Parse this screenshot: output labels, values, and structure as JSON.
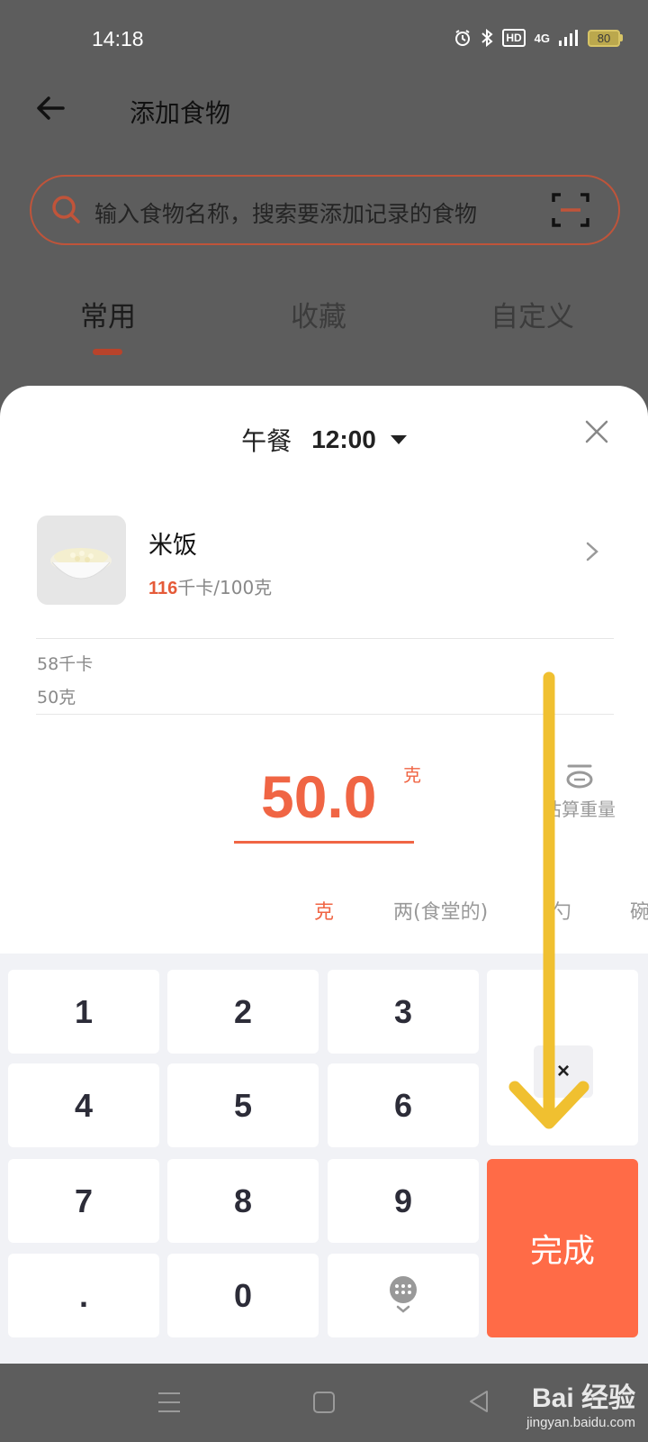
{
  "status_bar": {
    "time": "14:18",
    "hd_label": "HD",
    "network": "4G",
    "battery": "80",
    "icons": [
      "alarm-icon",
      "bluetooth-icon",
      "signal-icon",
      "battery-icon"
    ]
  },
  "header": {
    "title": "添加食物"
  },
  "search": {
    "placeholder": "输入食物名称，搜索要添加记录的食物"
  },
  "tabs": [
    {
      "label": "常用",
      "active": true
    },
    {
      "label": "收藏",
      "active": false
    },
    {
      "label": "自定义",
      "active": false
    }
  ],
  "sheet": {
    "meal": "午餐",
    "time": "12:00",
    "food": {
      "name": "米饭",
      "calories": "116",
      "calories_suffix": "千卡/100克"
    },
    "summary": {
      "calories": "58千卡",
      "weight": "50克"
    },
    "amount": {
      "value": "50.0",
      "unit": "克"
    },
    "estimate_label": "估算重量",
    "units": [
      {
        "label": "克",
        "active": true
      },
      {
        "label": "两(食堂的)",
        "active": false
      },
      {
        "label": "勺",
        "active": false
      },
      {
        "label": "碗",
        "active": false
      }
    ]
  },
  "keypad": {
    "keys": [
      "1",
      "2",
      "3",
      "4",
      "5",
      "6",
      "7",
      "8",
      "9",
      ".",
      "0"
    ],
    "delete_label": "×",
    "done_label": "完成"
  },
  "colors": {
    "accent": "#f06544",
    "done_button": "#ff6b47",
    "overlay_arrow": "#f0c030"
  },
  "watermark": {
    "brand": "Bai 经验",
    "url": "jingyan.baidu.com"
  }
}
